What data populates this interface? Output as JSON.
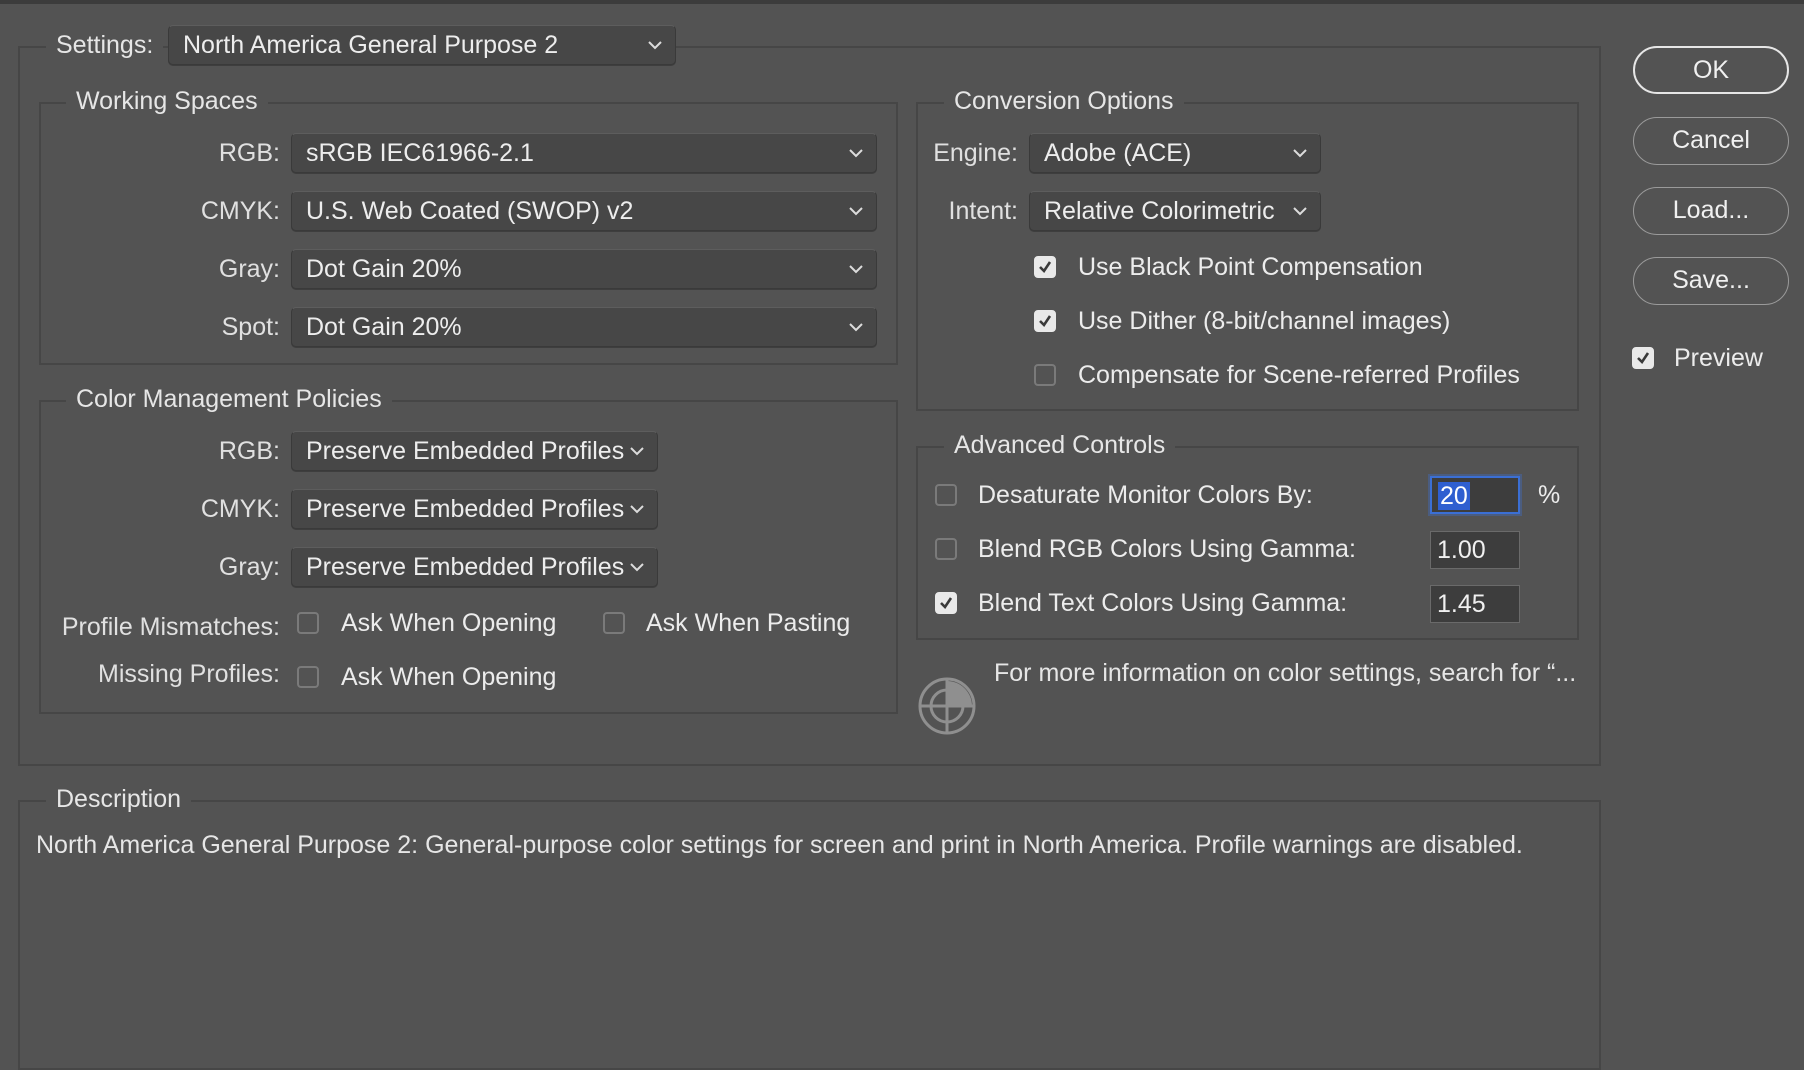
{
  "settings": {
    "label": "Settings:",
    "value": "North America General Purpose 2"
  },
  "working_spaces": {
    "title": "Working Spaces",
    "rows": [
      {
        "label": "RGB:",
        "value": "sRGB IEC61966-2.1"
      },
      {
        "label": "CMYK:",
        "value": "U.S. Web Coated (SWOP) v2"
      },
      {
        "label": "Gray:",
        "value": "Dot Gain 20%"
      },
      {
        "label": "Spot:",
        "value": "Dot Gain 20%"
      }
    ]
  },
  "policies": {
    "title": "Color Management Policies",
    "rows": [
      {
        "label": "RGB:",
        "value": "Preserve Embedded Profiles"
      },
      {
        "label": "CMYK:",
        "value": "Preserve Embedded Profiles"
      },
      {
        "label": "Gray:",
        "value": "Preserve Embedded Profiles"
      }
    ],
    "mismatch_label": "Profile Mismatches:",
    "ask_opening": {
      "label": "Ask When Opening",
      "checked": false
    },
    "ask_pasting": {
      "label": "Ask When Pasting",
      "checked": false
    },
    "missing_label": "Missing Profiles:",
    "missing_ask_opening": {
      "label": "Ask When Opening",
      "checked": false
    }
  },
  "conversion": {
    "title": "Conversion Options",
    "engine_label": "Engine:",
    "engine_value": "Adobe (ACE)",
    "intent_label": "Intent:",
    "intent_value": "Relative Colorimetric",
    "options": [
      {
        "label": "Use Black Point Compensation",
        "checked": true
      },
      {
        "label": "Use Dither (8-bit/channel images)",
        "checked": true
      },
      {
        "label": "Compensate for Scene-referred Profiles",
        "checked": false
      }
    ]
  },
  "advanced": {
    "title": "Advanced Controls",
    "rows": [
      {
        "label": "Desaturate Monitor Colors By:",
        "value": "20",
        "unit": "%",
        "checked": false
      },
      {
        "label": "Blend RGB Colors Using Gamma:",
        "value": "1.00",
        "checked": false
      },
      {
        "label": "Blend Text Colors Using Gamma:",
        "value": "1.45",
        "checked": true
      }
    ]
  },
  "info_text": "For more information on color settings, search for “...",
  "description": {
    "title": "Description",
    "text": "North America General Purpose 2:  General-purpose color settings for screen and print in North America. Profile warnings are disabled."
  },
  "buttons": {
    "ok": "OK",
    "cancel": "Cancel",
    "load": "Load...",
    "save": "Save..."
  },
  "preview": {
    "label": "Preview",
    "checked": true
  },
  "colors": {
    "background": "#535353",
    "focus": "#3b6fd4"
  }
}
